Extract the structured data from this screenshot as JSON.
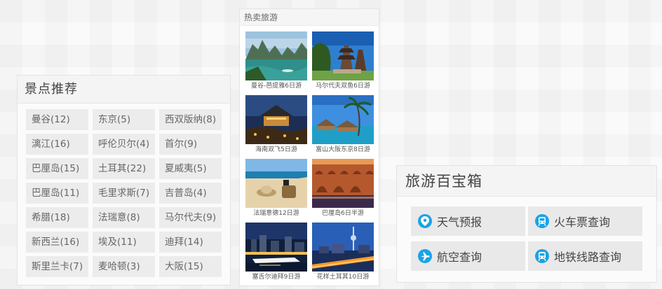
{
  "attractions": {
    "title": "景点推荐",
    "items": [
      {
        "label": "曼谷(12)"
      },
      {
        "label": "东京(5)"
      },
      {
        "label": "西双版纳(8)"
      },
      {
        "label": "漓江(16)"
      },
      {
        "label": "呼伦贝尔(4)"
      },
      {
        "label": "首尔(9)"
      },
      {
        "label": "巴厘岛(15)"
      },
      {
        "label": "土耳其(22)"
      },
      {
        "label": "夏威夷(5)"
      },
      {
        "label": "巴厘岛(11)"
      },
      {
        "label": "毛里求斯(7)"
      },
      {
        "label": "吉普岛(4)"
      },
      {
        "label": "希腊(18)"
      },
      {
        "label": "法瑞意(8)"
      },
      {
        "label": "马尔代夫(9)"
      },
      {
        "label": "新西兰(16)"
      },
      {
        "label": "埃及(11)"
      },
      {
        "label": "迪拜(14)"
      },
      {
        "label": "斯里兰卡(7)"
      },
      {
        "label": "麦哈顿(3)"
      },
      {
        "label": "大阪(15)"
      }
    ]
  },
  "hot_tours": {
    "title": "热卖旅游",
    "items": [
      {
        "caption": "曼谷-芭提雅6日游"
      },
      {
        "caption": "马尔代夫双鱼6日游"
      },
      {
        "caption": "海南双飞5日游"
      },
      {
        "caption": "富山大阪东京8日游"
      },
      {
        "caption": "法瑞意德12日游"
      },
      {
        "caption": "巴厘岛6日半游"
      },
      {
        "caption": "塞舌尔迪拜9日游"
      },
      {
        "caption": "花样土耳其10日游"
      }
    ]
  },
  "toolbox": {
    "title": "旅游百宝箱",
    "items": [
      {
        "label": "天气预报",
        "icon": "location-pin-icon"
      },
      {
        "label": "火车票查询",
        "icon": "train-icon"
      },
      {
        "label": "航空查询",
        "icon": "airplane-icon"
      },
      {
        "label": "地铁线路查询",
        "icon": "subway-icon"
      }
    ]
  },
  "colors": {
    "accent": "#1aa3e6",
    "tile_bg": "#ececec",
    "panel_border": "#e3e3e3"
  }
}
